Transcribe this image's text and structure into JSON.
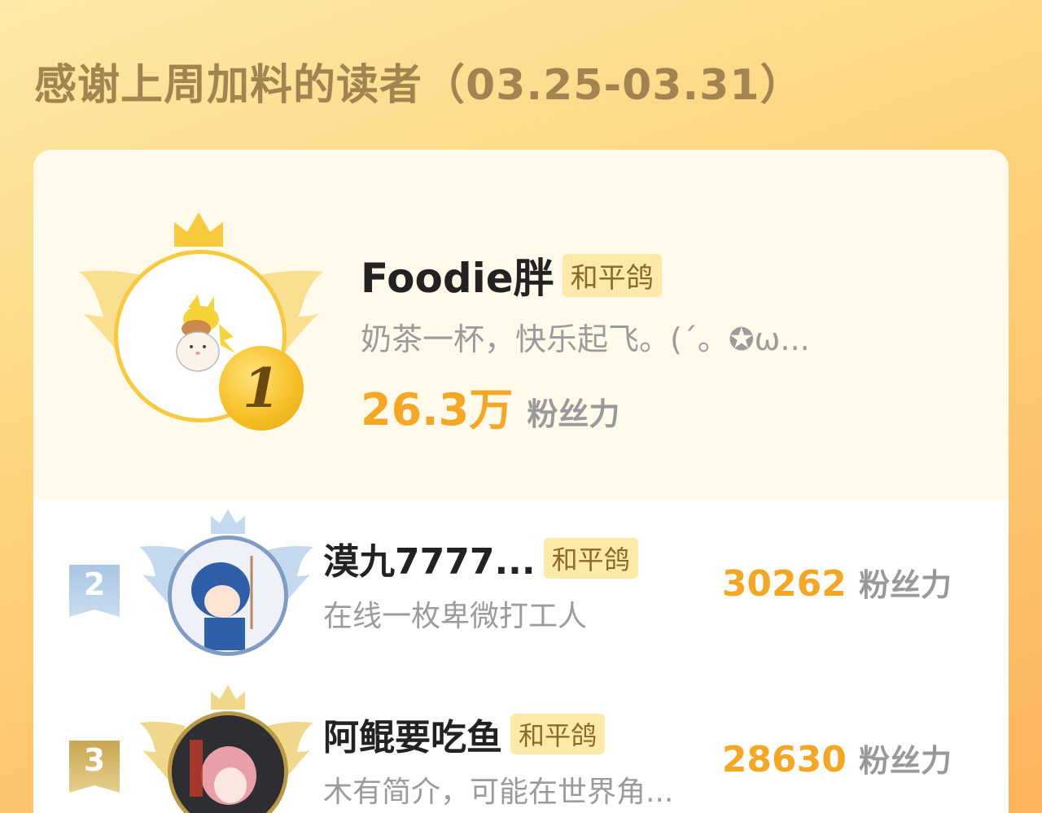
{
  "header": {
    "title": "感谢上周加料的读者（03.25-03.31）"
  },
  "colors": {
    "accent": "#f5a623",
    "title": "#a38350",
    "tag_bg": "#fdeaa9",
    "gold": "#f9c93d",
    "silver": "#7f9cc4",
    "bronze": "#b99943"
  },
  "readers": [
    {
      "rank": "1",
      "name": "Foodie胖",
      "tag": "和平鸽",
      "bio": "奶茶一杯，快乐起飞。(´。✪ω...",
      "fans_value": "26.3万",
      "fans_label": "粉丝力"
    },
    {
      "rank": "2",
      "name": "漠九7777...",
      "tag": "和平鸽",
      "bio": "在线一枚卑微打工人",
      "fans_value": "30262",
      "fans_label": "粉丝力"
    },
    {
      "rank": "3",
      "name": "阿鲲要吃鱼",
      "tag": "和平鸽",
      "bio": "木有简介，可能在世界角...",
      "fans_value": "28630",
      "fans_label": "粉丝力"
    }
  ],
  "icons": {
    "crown": "crown-icon",
    "wings": "wing-icon",
    "medal": "rank-medal-icon"
  }
}
